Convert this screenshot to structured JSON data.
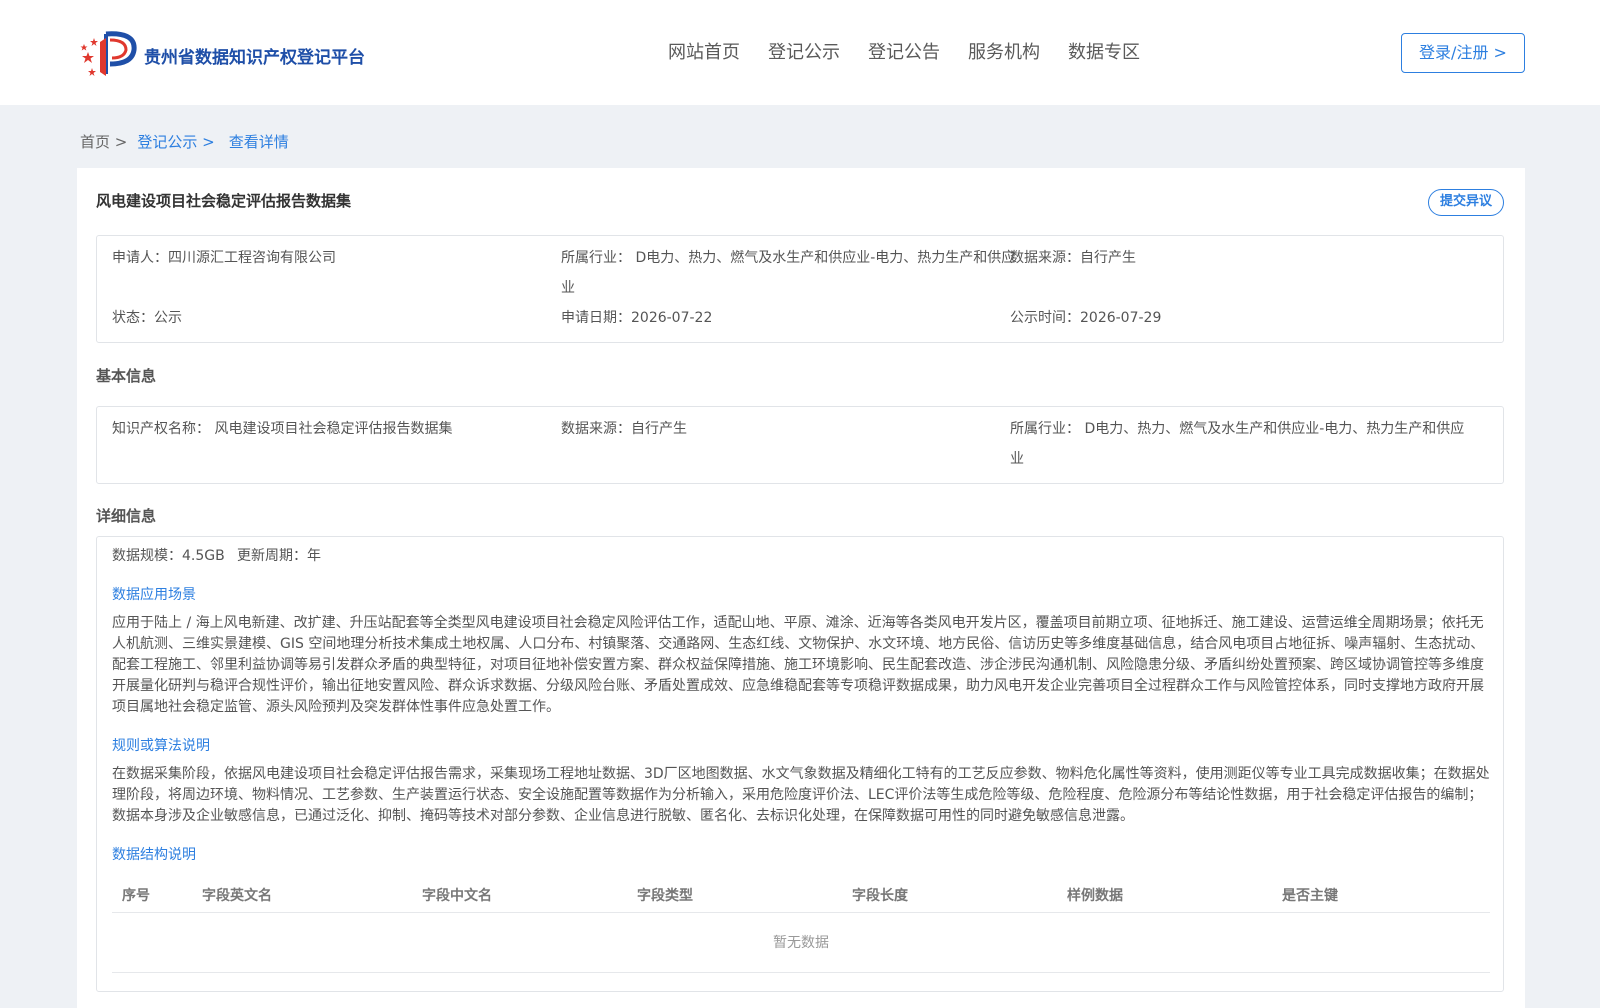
{
  "header": {
    "site_title": "贵州省数据知识产权登记平台",
    "nav": [
      "网站首页",
      "登记公示",
      "登记公告",
      "服务机构",
      "数据专区"
    ],
    "login_label": "登录/注册 >"
  },
  "breadcrumb": {
    "home": "首页 >",
    "section": "登记公示 >",
    "current": "查看详情"
  },
  "detail": {
    "title": "风电建设项目社会稳定评估报告数据集",
    "objection_label": "提交异议",
    "summary": {
      "applicant": "申请人：四川源汇工程咨询有限公司",
      "industry_line1": "所属行业： D电力、热力、燃气及水生产和供应业-电力、热力生产和供应",
      "industry_line2": "业",
      "source": "数据来源：自行产生",
      "status": "状态：公示",
      "apply_date": "申请日期：2026-07-22",
      "publish_date": "公示时间：2026-07-29"
    },
    "basic_title": "基本信息",
    "basic": {
      "ip_name": "知识产权名称： 风电建设项目社会稳定评估报告数据集",
      "source": "数据来源：自行产生",
      "industry_line1": "所属行业： D电力、热力、燃气及水生产和供应业-电力、热力生产和供应",
      "industry_line2": "业"
    },
    "detail_title": "详细信息",
    "scale": "数据规模：4.5GB",
    "cycle": "更新周期：年",
    "scenario_title": "数据应用场景",
    "scenario_text": "应用于陆上 / 海上风电新建、改扩建、升压站配套等全类型风电建设项目社会稳定风险评估工作，适配山地、平原、滩涂、近海等各类风电开发片区，覆盖项目前期立项、征地拆迁、施工建设、运营运维全周期场景；依托无人机航测、三维实景建模、GIS 空间地理分析技术集成土地权属、人口分布、村镇聚落、交通路网、生态红线、文物保护、水文环境、地方民俗、信访历史等多维度基础信息，结合风电项目占地征拆、噪声辐射、生态扰动、配套工程施工、邻里利益协调等易引发群众矛盾的典型特征，对项目征地补偿安置方案、群众权益保障措施、施工环境影响、民生配套改造、涉企涉民沟通机制、风险隐患分级、矛盾纠纷处置预案、跨区域协调管控等多维度开展量化研判与稳评合规性评价，输出征地安置风险、群众诉求数据、分级风险台账、矛盾处置成效、应急维稳配套等专项稳评数据成果，助力风电开发企业完善项目全过程群众工作与风险管控体系，同时支撑地方政府开展项目属地社会稳定监管、源头风险预判及突发群体性事件应急处置工作。",
    "rule_title": "规则或算法说明",
    "rule_text": "在数据采集阶段，依据风电建设项目社会稳定评估报告需求，采集现场工程地址数据、3D厂区地图数据、水文气象数据及精细化工特有的工艺反应参数、物料危化属性等资料，使用测距仪等专业工具完成数据收集；在数据处理阶段，将周边环境、物料情况、工艺参数、生产装置运行状态、安全设施配置等数据作为分析输入，采用危险度评价法、LEC评价法等生成危险等级、危险程度、危险源分布等结论性数据，用于社会稳定评估报告的编制；数据本身涉及企业敏感信息，已通过泛化、抑制、掩码等技术对部分参数、企业信息进行脱敏、匿名化、去标识化处理，在保障数据可用性的同时避免敏感信息泄露。",
    "structure_title": "数据结构说明",
    "table_headers": [
      "序号",
      "字段英文名",
      "字段中文名",
      "字段类型",
      "字段长度",
      "样例数据",
      "是否主键"
    ],
    "empty_text": "暂无数据"
  },
  "colors": {
    "accent": "#2d7fe0",
    "brand": "#1f4fa8",
    "background": "#eef1f5"
  }
}
